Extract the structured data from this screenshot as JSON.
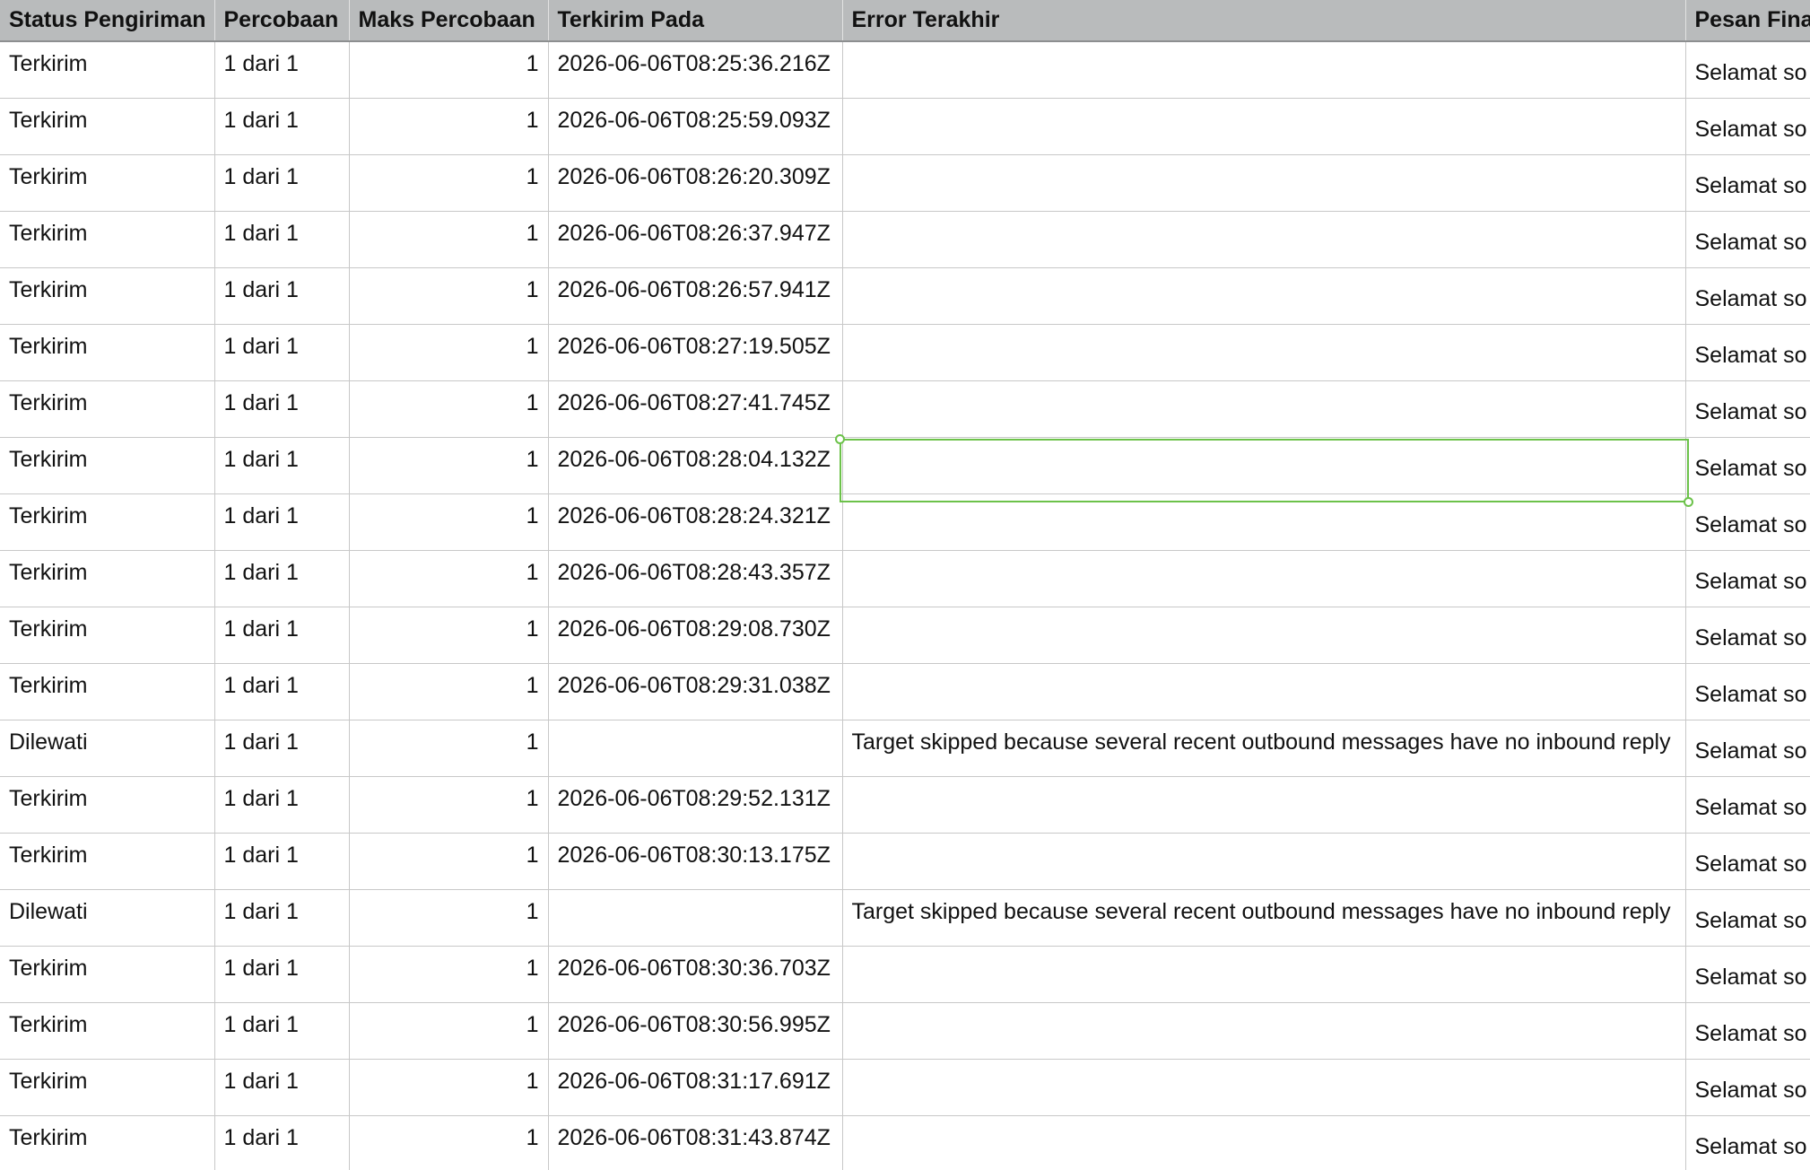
{
  "table": {
    "headers": {
      "status": "Status Pengiriman",
      "attempt": "Percobaan",
      "max_attempts": "Maks Percobaan",
      "sent_at": "Terkirim Pada",
      "last_error": "Error Terakhir",
      "final_message": "Pesan Fina"
    },
    "rows": [
      {
        "status": "Terkirim",
        "attempt": "1 dari 1",
        "max_attempts": "1",
        "sent_at": "2026-06-06T08:25:36.216Z",
        "last_error": "",
        "final_message": "Selamat so"
      },
      {
        "status": "Terkirim",
        "attempt": "1 dari 1",
        "max_attempts": "1",
        "sent_at": "2026-06-06T08:25:59.093Z",
        "last_error": "",
        "final_message": "Selamat so"
      },
      {
        "status": "Terkirim",
        "attempt": "1 dari 1",
        "max_attempts": "1",
        "sent_at": "2026-06-06T08:26:20.309Z",
        "last_error": "",
        "final_message": "Selamat so"
      },
      {
        "status": "Terkirim",
        "attempt": "1 dari 1",
        "max_attempts": "1",
        "sent_at": "2026-06-06T08:26:37.947Z",
        "last_error": "",
        "final_message": "Selamat so"
      },
      {
        "status": "Terkirim",
        "attempt": "1 dari 1",
        "max_attempts": "1",
        "sent_at": "2026-06-06T08:26:57.941Z",
        "last_error": "",
        "final_message": "Selamat so"
      },
      {
        "status": "Terkirim",
        "attempt": "1 dari 1",
        "max_attempts": "1",
        "sent_at": "2026-06-06T08:27:19.505Z",
        "last_error": "",
        "final_message": "Selamat so"
      },
      {
        "status": "Terkirim",
        "attempt": "1 dari 1",
        "max_attempts": "1",
        "sent_at": "2026-06-06T08:27:41.745Z",
        "last_error": "",
        "final_message": "Selamat so"
      },
      {
        "status": "Terkirim",
        "attempt": "1 dari 1",
        "max_attempts": "1",
        "sent_at": "2026-06-06T08:28:04.132Z",
        "last_error": "",
        "final_message": "Selamat so"
      },
      {
        "status": "Terkirim",
        "attempt": "1 dari 1",
        "max_attempts": "1",
        "sent_at": "2026-06-06T08:28:24.321Z",
        "last_error": "",
        "final_message": "Selamat so"
      },
      {
        "status": "Terkirim",
        "attempt": "1 dari 1",
        "max_attempts": "1",
        "sent_at": "2026-06-06T08:28:43.357Z",
        "last_error": "",
        "final_message": "Selamat so"
      },
      {
        "status": "Terkirim",
        "attempt": "1 dari 1",
        "max_attempts": "1",
        "sent_at": "2026-06-06T08:29:08.730Z",
        "last_error": "",
        "final_message": "Selamat so"
      },
      {
        "status": "Terkirim",
        "attempt": "1 dari 1",
        "max_attempts": "1",
        "sent_at": "2026-06-06T08:29:31.038Z",
        "last_error": "",
        "final_message": "Selamat so"
      },
      {
        "status": "Dilewati",
        "attempt": "1 dari 1",
        "max_attempts": "1",
        "sent_at": "",
        "last_error": "Target skipped because several recent outbound messages have no inbound reply",
        "final_message": "Selamat so"
      },
      {
        "status": "Terkirim",
        "attempt": "1 dari 1",
        "max_attempts": "1",
        "sent_at": "2026-06-06T08:29:52.131Z",
        "last_error": "",
        "final_message": "Selamat so"
      },
      {
        "status": "Terkirim",
        "attempt": "1 dari 1",
        "max_attempts": "1",
        "sent_at": "2026-06-06T08:30:13.175Z",
        "last_error": "",
        "final_message": "Selamat so"
      },
      {
        "status": "Dilewati",
        "attempt": "1 dari 1",
        "max_attempts": "1",
        "sent_at": "",
        "last_error": "Target skipped because several recent outbound messages have no inbound reply",
        "final_message": "Selamat so"
      },
      {
        "status": "Terkirim",
        "attempt": "1 dari 1",
        "max_attempts": "1",
        "sent_at": "2026-06-06T08:30:36.703Z",
        "last_error": "",
        "final_message": "Selamat so"
      },
      {
        "status": "Terkirim",
        "attempt": "1 dari 1",
        "max_attempts": "1",
        "sent_at": "2026-06-06T08:30:56.995Z",
        "last_error": "",
        "final_message": "Selamat so"
      },
      {
        "status": "Terkirim",
        "attempt": "1 dari 1",
        "max_attempts": "1",
        "sent_at": "2026-06-06T08:31:17.691Z",
        "last_error": "",
        "final_message": "Selamat so"
      },
      {
        "status": "Terkirim",
        "attempt": "1 dari 1",
        "max_attempts": "1",
        "sent_at": "2026-06-06T08:31:43.874Z",
        "last_error": "",
        "final_message": "Selamat so"
      }
    ]
  },
  "selection": {
    "row": 8,
    "column": "last_error",
    "color": "#6cc24a"
  }
}
